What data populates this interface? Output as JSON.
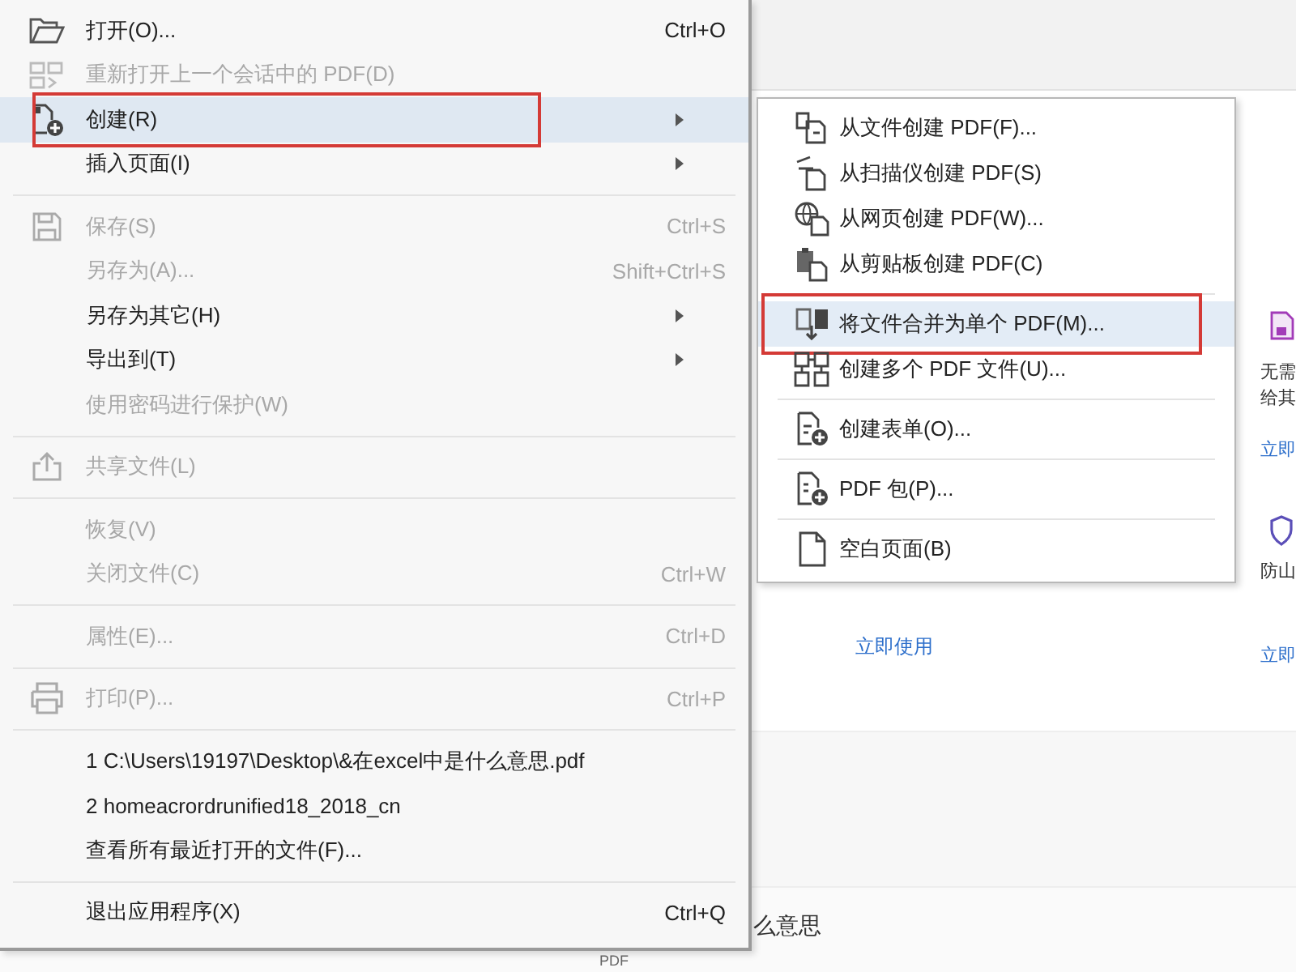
{
  "menu": {
    "items": [
      {
        "kind": "item",
        "label": "打开(O)...",
        "shortcut": "Ctrl+O",
        "disabled": false,
        "submenu": false,
        "selected": false,
        "outlined": false
      },
      {
        "kind": "item",
        "label": "重新打开上一个会话中的 PDF(D)",
        "disabled": true,
        "submenu": false,
        "selected": false,
        "outlined": false
      },
      {
        "kind": "item",
        "label": "创建(R)",
        "disabled": false,
        "submenu": true,
        "selected": true,
        "outlined": true
      },
      {
        "kind": "item",
        "label": "插入页面(I)",
        "disabled": false,
        "submenu": true,
        "selected": false,
        "outlined": false
      },
      {
        "kind": "separator"
      },
      {
        "kind": "item",
        "label": "保存(S)",
        "shortcut": "Ctrl+S",
        "disabled": true,
        "submenu": false,
        "selected": false,
        "outlined": false
      },
      {
        "kind": "item",
        "label": "另存为(A)...",
        "shortcut": "Shift+Ctrl+S",
        "disabled": true,
        "submenu": false,
        "selected": false,
        "outlined": false
      },
      {
        "kind": "item",
        "label": "另存为其它(H)",
        "disabled": false,
        "submenu": true,
        "selected": false,
        "outlined": false
      },
      {
        "kind": "item",
        "label": "导出到(T)",
        "disabled": false,
        "submenu": true,
        "selected": false,
        "outlined": false
      },
      {
        "kind": "item",
        "label": "使用密码进行保护(W)",
        "disabled": true,
        "submenu": false,
        "selected": false,
        "outlined": false
      },
      {
        "kind": "separator"
      },
      {
        "kind": "item",
        "label": "共享文件(L)",
        "disabled": true,
        "submenu": false,
        "selected": false,
        "outlined": false
      },
      {
        "kind": "separator"
      },
      {
        "kind": "item",
        "label": "恢复(V)",
        "disabled": true,
        "submenu": false,
        "selected": false,
        "outlined": false
      },
      {
        "kind": "item",
        "label": "关闭文件(C)",
        "shortcut": "Ctrl+W",
        "disabled": true,
        "submenu": false,
        "selected": false,
        "outlined": false
      },
      {
        "kind": "separator"
      },
      {
        "kind": "item",
        "label": "属性(E)...",
        "shortcut": "Ctrl+D",
        "disabled": true,
        "submenu": false,
        "selected": false,
        "outlined": false
      },
      {
        "kind": "separator"
      },
      {
        "kind": "item",
        "label": "打印(P)...",
        "shortcut": "Ctrl+P",
        "disabled": true,
        "submenu": false,
        "selected": false,
        "outlined": false
      },
      {
        "kind": "separator"
      },
      {
        "kind": "item",
        "label": "1 C:\\Users\\19197\\Desktop\\&在excel中是什么意思.pdf",
        "disabled": false,
        "submenu": false,
        "selected": false,
        "outlined": false
      },
      {
        "kind": "item",
        "label": "2 homeacrordrunified18_2018_cn",
        "disabled": false,
        "submenu": false,
        "selected": false,
        "outlined": false
      },
      {
        "kind": "item",
        "label": "查看所有最近打开的文件(F)...",
        "disabled": false,
        "submenu": false,
        "selected": false,
        "outlined": false
      },
      {
        "kind": "separator"
      },
      {
        "kind": "item",
        "label": "退出应用程序(X)",
        "shortcut": "Ctrl+Q",
        "disabled": false,
        "submenu": false,
        "selected": false,
        "outlined": false
      }
    ]
  },
  "submenu": {
    "items": [
      {
        "kind": "item",
        "label": "从文件创建 PDF(F)...",
        "selected": false,
        "outlined": false
      },
      {
        "kind": "item",
        "label": "从扫描仪创建 PDF(S)",
        "selected": false,
        "outlined": false
      },
      {
        "kind": "item",
        "label": "从网页创建 PDF(W)...",
        "selected": false,
        "outlined": false
      },
      {
        "kind": "item",
        "label": "从剪贴板创建 PDF(C)",
        "selected": false,
        "outlined": false
      },
      {
        "kind": "separator"
      },
      {
        "kind": "item",
        "label": "将文件合并为单个 PDF(M)...",
        "selected": true,
        "outlined": true
      },
      {
        "kind": "item",
        "label": "创建多个 PDF 文件(U)...",
        "selected": false,
        "outlined": false
      },
      {
        "kind": "separator"
      },
      {
        "kind": "item",
        "label": "创建表单(O)...",
        "selected": false,
        "outlined": false
      },
      {
        "kind": "separator"
      },
      {
        "kind": "item",
        "label": "PDF 包(P)...",
        "selected": false,
        "outlined": false
      },
      {
        "kind": "separator"
      },
      {
        "kind": "item",
        "label": "空白页面(B)",
        "selected": false,
        "outlined": false
      }
    ]
  },
  "background": {
    "link_left": "立即使用",
    "side_texts": [
      "无需",
      "给其"
    ],
    "side_link_1": "立即",
    "side_text_2": "防山",
    "side_link_2": "立即",
    "bottom_text": "么意思",
    "pdf_label": "PDF"
  }
}
